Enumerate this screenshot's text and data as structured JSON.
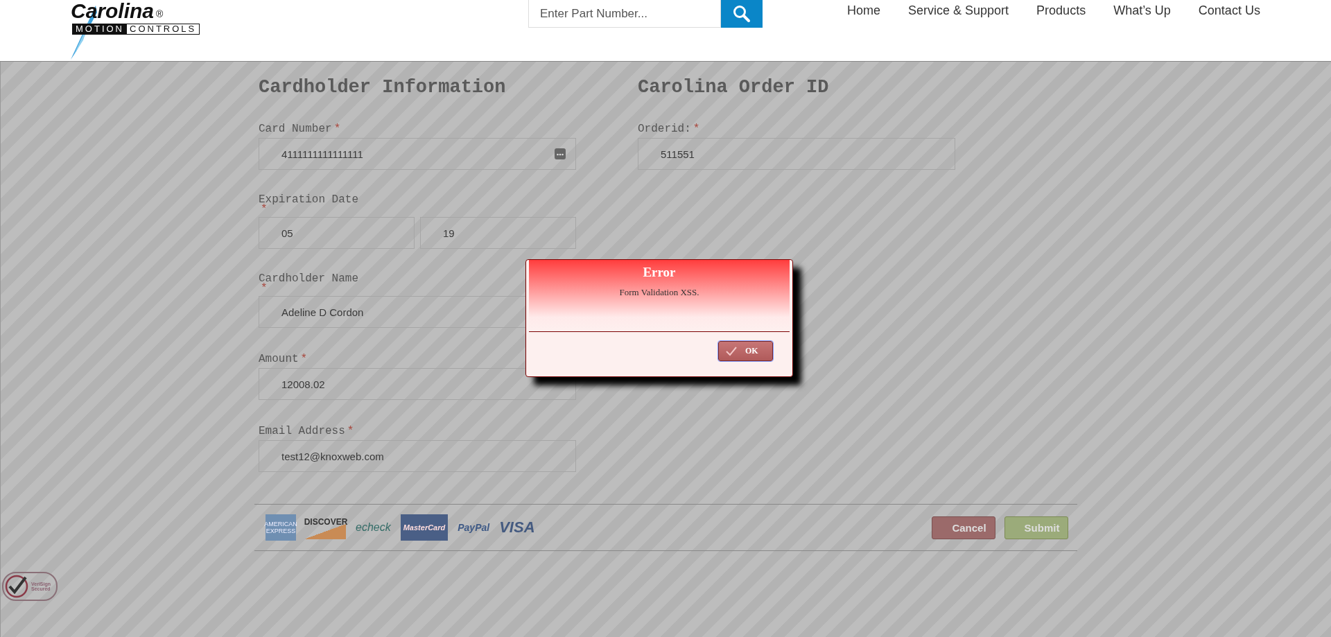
{
  "header": {
    "logo": {
      "name": "Carolina",
      "tagline_left": "MOTION",
      "tagline_right": "CONTROLS",
      "mark": "®"
    },
    "search": {
      "placeholder": "Enter Part Number..."
    },
    "nav": [
      {
        "label": "Home"
      },
      {
        "label": "Service & Support"
      },
      {
        "label": "Products"
      },
      {
        "label": "What’s Up"
      },
      {
        "label": "Contact Us"
      }
    ]
  },
  "form": {
    "columns": [
      {
        "title": "Cardholder Information",
        "fields": [
          {
            "label": "Card Number",
            "star": "*",
            "values": [
              "4111111111111111"
            ],
            "icon": true,
            "star_below": false
          },
          {
            "label": "Expiration Date",
            "star": "*",
            "values": [
              "05",
              "19"
            ],
            "icon": false,
            "star_below": true
          },
          {
            "label": "Cardholder Name",
            "star": "*",
            "values": [
              "Adeline D Cordon"
            ],
            "icon": false,
            "star_below": true
          },
          {
            "label": "Amount",
            "star": "*",
            "values": [
              "12008.02"
            ],
            "icon": false,
            "star_below": false
          },
          {
            "label": "Email Address",
            "star": "*",
            "values": [
              "test12@knoxweb.com"
            ],
            "icon": false,
            "star_below": false
          }
        ]
      },
      {
        "title": "Carolina Order ID",
        "fields": [
          {
            "label": "Orderid:",
            "star": "*",
            "values": [
              "511551"
            ],
            "icon": false,
            "star_below": false
          }
        ]
      }
    ]
  },
  "footer": {
    "cards": [
      {
        "kind": "amex",
        "text": "AMERICAN EXPRESS"
      },
      {
        "kind": "discover",
        "text": "DISCOVER"
      },
      {
        "kind": "echeck",
        "text": "echeck"
      },
      {
        "kind": "mastercard",
        "text": "MasterCard"
      },
      {
        "kind": "paypal",
        "text": "PayPal"
      },
      {
        "kind": "visa",
        "text": "VISA"
      }
    ],
    "buttons": [
      {
        "kind": "cancel",
        "label": "Cancel"
      },
      {
        "kind": "submit",
        "label": "Submit"
      }
    ]
  },
  "seal": {
    "line1": "VeriSign",
    "line2": "Secured"
  },
  "dialog": {
    "title": "Error",
    "message": "Form Validation XSS.",
    "button": "OK"
  }
}
